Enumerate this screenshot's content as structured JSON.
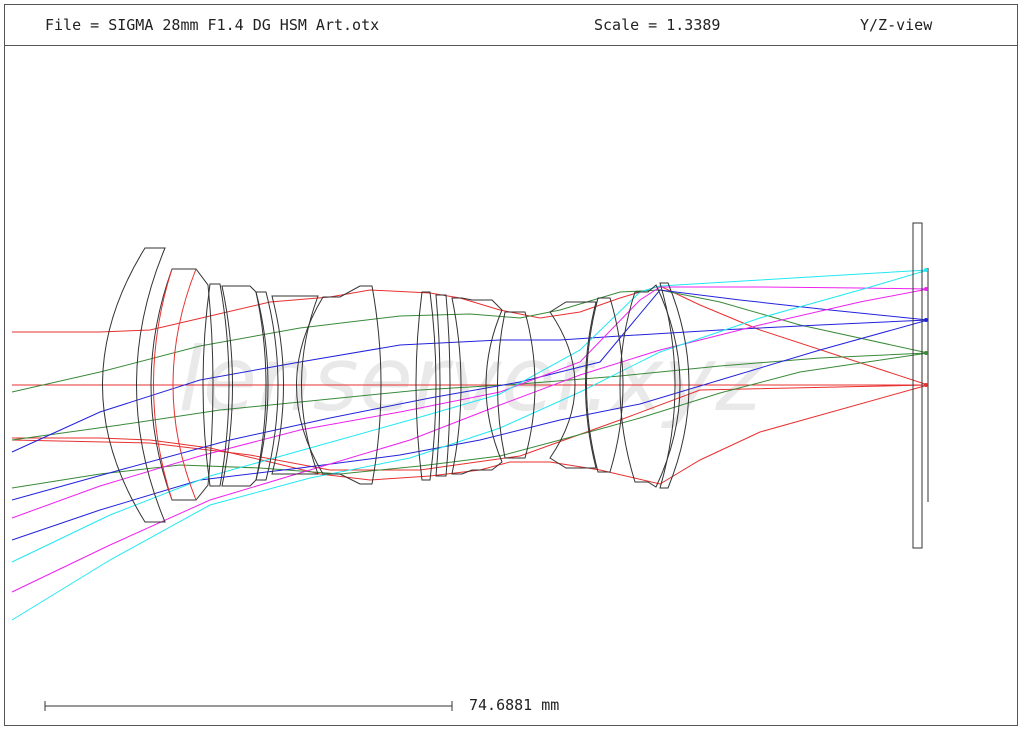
{
  "header": {
    "file": "File = SIGMA 28mm F1.4 DG HSM Art.otx",
    "scale": "Scale = 1.3389",
    "view": "Y/Z-view"
  },
  "scale_bar": {
    "label": "74.6881 mm"
  },
  "watermark": "lenserver.xyz",
  "colors": {
    "frame": "#555555",
    "lens": "#333333",
    "red": "#e8302f",
    "blue": "#2222dd",
    "green": "#3a8a3a",
    "magenta": "#ee22ee",
    "cyan": "#22e8f0"
  }
}
